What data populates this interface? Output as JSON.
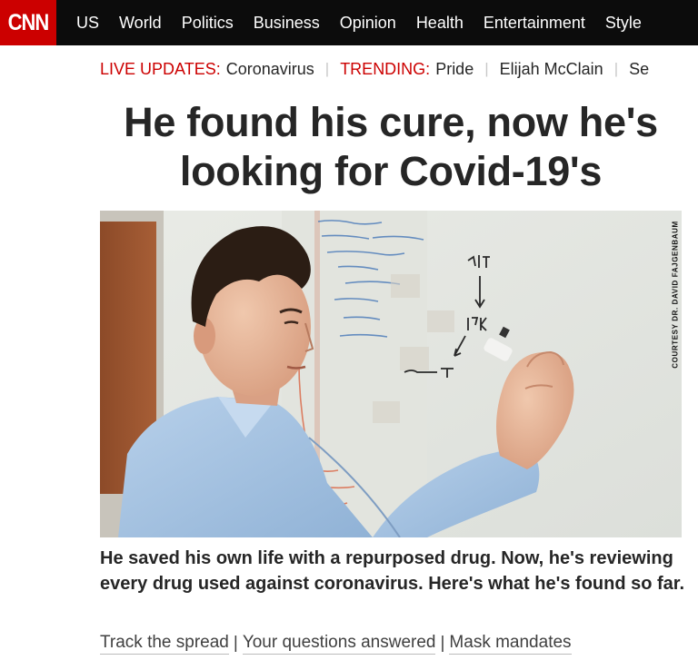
{
  "nav": {
    "logo": "CNN",
    "items": [
      "US",
      "World",
      "Politics",
      "Business",
      "Opinion",
      "Health",
      "Entertainment",
      "Style"
    ]
  },
  "trending": {
    "live_label": "LIVE UPDATES:",
    "live_link": "Coronavirus",
    "trending_label": "TRENDING:",
    "items": [
      "Pride",
      "Elijah McClain",
      "Se"
    ]
  },
  "headline": "He found his cure, now he's looking for Covid-19's",
  "photo": {
    "credit": "COURTESY DR. DAVID FAJGENBAUM"
  },
  "caption": "He saved his own life with a repurposed drug. Now, he's reviewing every drug used against coronavirus. Here's what he's found so far.",
  "related": [
    "Track the spread",
    "Your questions answered",
    "Mask mandates"
  ],
  "colors": {
    "brand_red": "#cc0000",
    "nav_bg": "#0c0c0c"
  }
}
